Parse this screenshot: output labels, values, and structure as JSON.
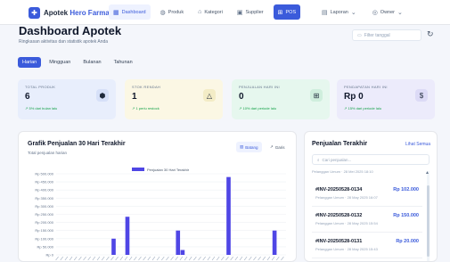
{
  "brand": {
    "logo_icon": "pharmacy-icon",
    "name": "Apotek",
    "accent": "Hero Farma"
  },
  "nav": [
    {
      "label": "Dashboard",
      "icon": "grid-icon",
      "state": "active"
    },
    {
      "label": "Produk",
      "icon": "box-icon",
      "state": "normal"
    },
    {
      "label": "Kategori",
      "icon": "tag-icon",
      "state": "normal"
    },
    {
      "label": "Supplier",
      "icon": "truck-icon",
      "state": "normal"
    },
    {
      "label": "POS",
      "icon": "cart-icon",
      "state": "pos"
    }
  ],
  "nav_right": {
    "laporan": "Laporan",
    "user": "Owner"
  },
  "page": {
    "title": "Dashboard Apotek",
    "subtitle": "Ringkasan aktivitas dan statistik apotek Anda",
    "date_placeholder": "Filter tanggal"
  },
  "periods": [
    "Harian",
    "Mingguan",
    "Bulanan",
    "Tahunan"
  ],
  "stats": [
    {
      "label": "Total Produk",
      "value": "6",
      "trend": "↗ 5% dari bulan lalu",
      "icon": "cube-icon"
    },
    {
      "label": "Stok Rendah",
      "value": "1",
      "trend": "↗ 1 perlu restock",
      "icon": "warning-icon"
    },
    {
      "label": "Penjualan Hari Ini",
      "value": "0",
      "trend": "↗ 10% dari periode lalu",
      "icon": "cart-icon"
    },
    {
      "label": "Pendapatan Hari Ini",
      "value": "Rp 0",
      "trend": "↗ 15% dari periode lalu",
      "icon": "dollar-icon"
    }
  ],
  "chart_panel": {
    "title": "Grafik Penjualan 30 Hari Terakhir",
    "subtitle": "Total penjualan harian",
    "toggle_bar": "Batang",
    "toggle_line": "Garis"
  },
  "chart_data": {
    "type": "bar",
    "legend": "Penjualan 30 Hari Terakhir",
    "y_ticks": [
      "Rp 0",
      "Rp 50.000",
      "Rp 100.000",
      "Rp 150.000",
      "Rp 200.000",
      "Rp 250.000",
      "Rp 300.000",
      "Rp 350.000",
      "Rp 400.000",
      "Rp 450.000",
      "Rp 500.000"
    ],
    "ylim": [
      0,
      500000
    ],
    "values": [
      0,
      0,
      0,
      0,
      0,
      0,
      0,
      0,
      0,
      0,
      0,
      0,
      100000,
      0,
      0,
      235000,
      0,
      0,
      0,
      0,
      0,
      0,
      0,
      0,
      0,
      0,
      150000,
      30000,
      0,
      0,
      0,
      0,
      0,
      0,
      0,
      0,
      0,
      480000,
      0,
      0,
      0,
      0,
      0,
      0,
      0,
      0,
      0,
      150000,
      0,
      0
    ]
  },
  "sales_panel": {
    "title": "Penjualan Terakhir",
    "link": "Lihat Semua",
    "search_placeholder": "Cari penjualan...",
    "cut_row": "Pelanggan Umum · 28 Mei 2025 18:10",
    "items": [
      {
        "invoice": "#INV-20250528-0134",
        "amount": "Rp 102.000",
        "meta": "Pelanggan Umum · 28 May 2025 16:07"
      },
      {
        "invoice": "#INV-20250528-0132",
        "amount": "Rp 150.000",
        "meta": "Pelanggan Umum · 28 May 2025 15:54"
      },
      {
        "invoice": "#INV-20250528-0131",
        "amount": "Rp 20.000",
        "meta": "Pelanggan Umum · 28 May 2025 15:43"
      }
    ]
  }
}
